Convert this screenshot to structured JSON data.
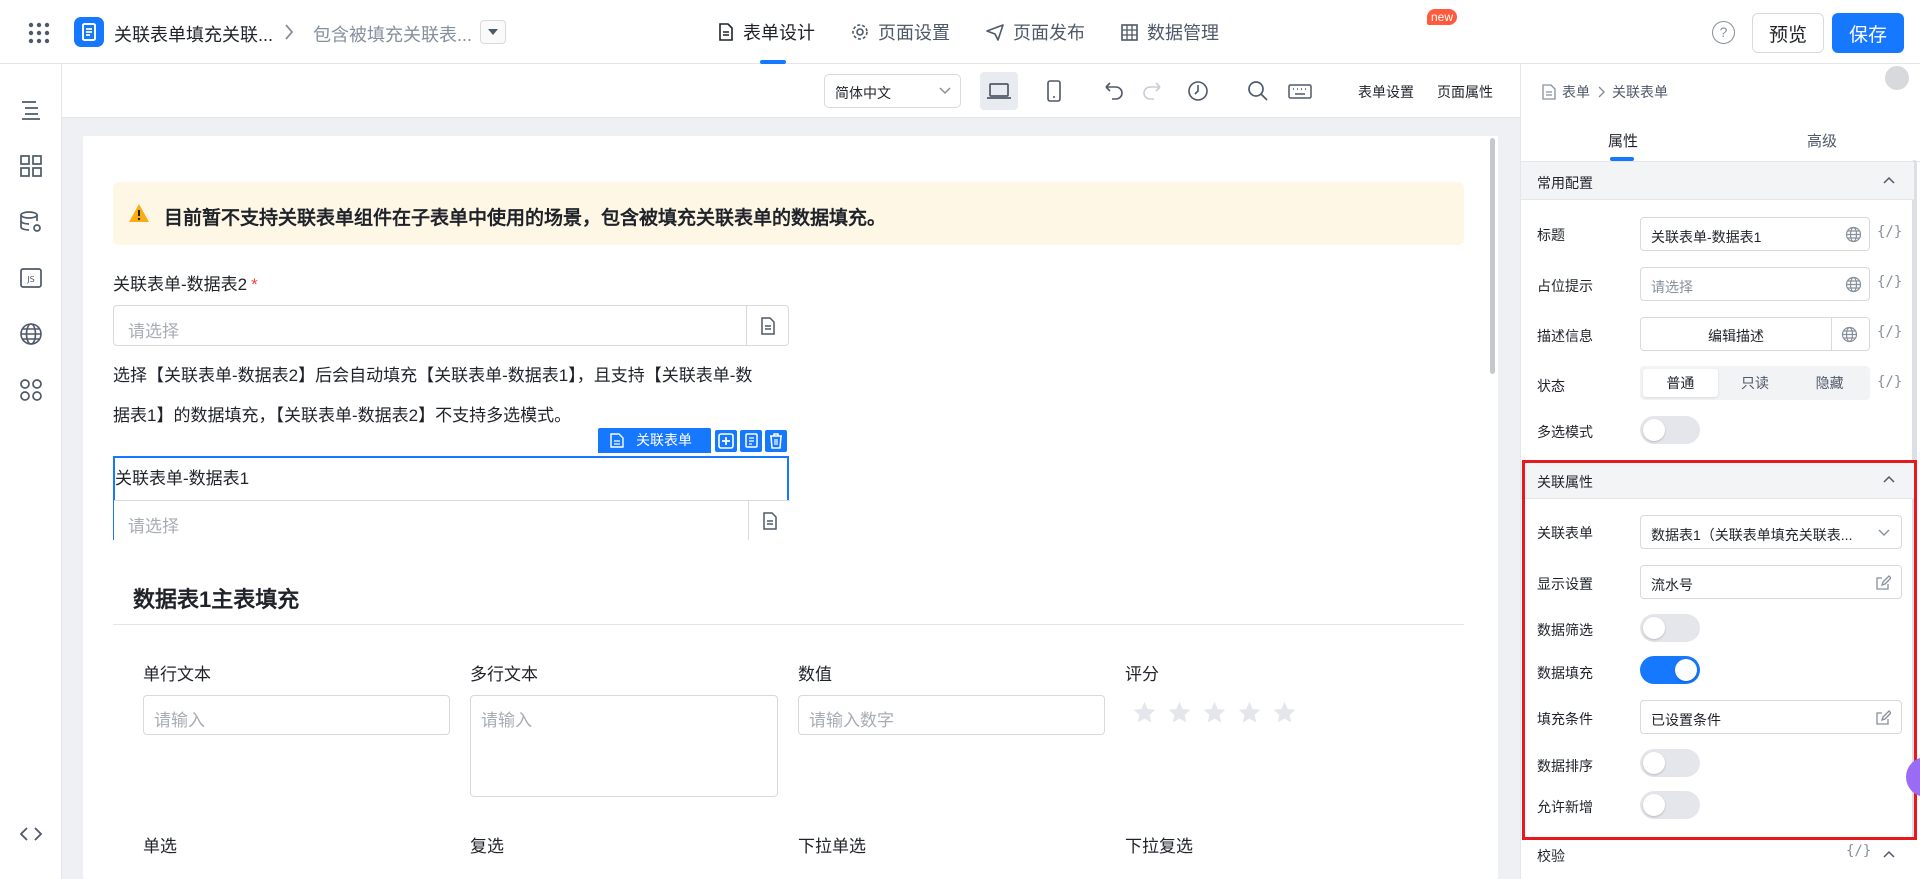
{
  "header": {
    "app_title": "关联表单填充关联...",
    "page_name": "包含被填充关联表...",
    "tabs": [
      {
        "label": "表单设计",
        "active": true
      },
      {
        "label": "页面设置",
        "active": false
      },
      {
        "label": "页面发布",
        "active": false
      },
      {
        "label": "数据管理",
        "active": false
      }
    ],
    "help_label": "?",
    "preview_label": "预览",
    "save_label": "保存",
    "accent_color": "#1677ff"
  },
  "left_rail": {
    "icons": [
      "outline-icon",
      "components-icon",
      "datasource-icon",
      "js-icon",
      "globe-icon",
      "plugins-icon"
    ],
    "bottom_icon": "code-icon",
    "js_label": "JS"
  },
  "toolbar": {
    "language": "简体中文",
    "form_settings": "表单设置",
    "page_properties": "页面属性",
    "new_badge": "new"
  },
  "canvas": {
    "alert_text": "目前暂不支持关联表单组件在子表单中使用的场景，包含被填充关联表单的数据填充。",
    "field1": {
      "label": "关联表单-数据表2",
      "required_mark": "*",
      "placeholder": "请选择"
    },
    "description_line1": "选择【关联表单-数据表2】后会自动填充【关联表单-数据表1】，且支持【关联表单-数",
    "description_line2": "据表1】的数据填充，【关联表单-数据表2】不支持多选模式。",
    "selected_component_tag": "关联表单",
    "field2": {
      "label": "关联表单-数据表1",
      "placeholder": "请选择"
    },
    "section_title": "数据表1主表填充",
    "row1": [
      {
        "label": "单行文本",
        "placeholder": "请输入"
      },
      {
        "label": "多行文本",
        "placeholder": "请输入"
      },
      {
        "label": "数值",
        "placeholder": "请输入数字"
      },
      {
        "label": "评分",
        "stars": 5
      }
    ],
    "row2": [
      "单选",
      "复选",
      "下拉单选",
      "下拉复选"
    ]
  },
  "right_panel": {
    "breadcrumb": [
      "表单",
      "关联表单"
    ],
    "tabs": [
      {
        "label": "属性",
        "active": true
      },
      {
        "label": "高级",
        "active": false
      }
    ],
    "var_label": "{/}",
    "common": {
      "title": "常用配置",
      "title_label": "标题",
      "title_value": "关联表单-数据表1",
      "placeholder_label": "占位提示",
      "placeholder_value": "请选择",
      "desc_label": "描述信息",
      "desc_button": "编辑描述",
      "state_label": "状态",
      "state_options": [
        "普通",
        "只读",
        "隐藏"
      ],
      "state_selected": "普通",
      "multi_label": "多选模式",
      "multi_on": false
    },
    "relation": {
      "title": "关联属性",
      "form_label": "关联表单",
      "form_value": "数据表1（关联表单填充关联表...",
      "display_label": "显示设置",
      "display_value": "流水号",
      "filter_label": "数据筛选",
      "filter_on": false,
      "fill_label": "数据填充",
      "fill_on": true,
      "cond_label": "填充条件",
      "cond_value": "已设置条件",
      "sort_label": "数据排序",
      "sort_on": false,
      "allow_add_label": "允许新增",
      "allow_add_on": false
    },
    "validate": {
      "title": "校验"
    }
  }
}
